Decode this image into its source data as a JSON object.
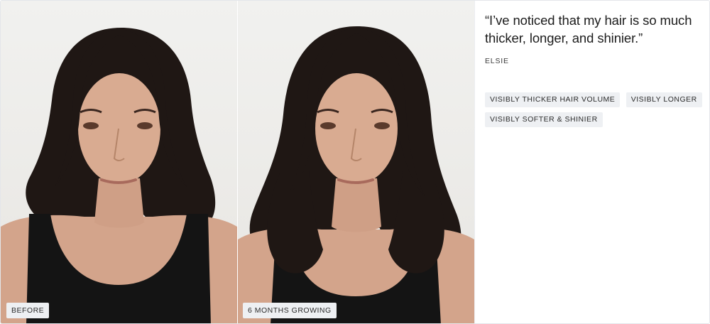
{
  "testimonial": {
    "quote": "“I’ve noticed that my hair is so much thicker, longer, and shinier.”",
    "author": "ELSIE",
    "tags": [
      "VISIBLY THICKER HAIR VOLUME",
      "VISIBLY LONGER",
      "VISIBLY SOFTER & SHINIER"
    ]
  },
  "photos": {
    "before": {
      "label": "BEFORE",
      "icon": "before-photo"
    },
    "after": {
      "label": "6 MONTHS GROWING",
      "icon": "after-photo"
    }
  },
  "colors": {
    "tag_background": "#eef0f3",
    "hair": "#1f1714",
    "skin": "#d8a98e",
    "top": "#141414"
  }
}
